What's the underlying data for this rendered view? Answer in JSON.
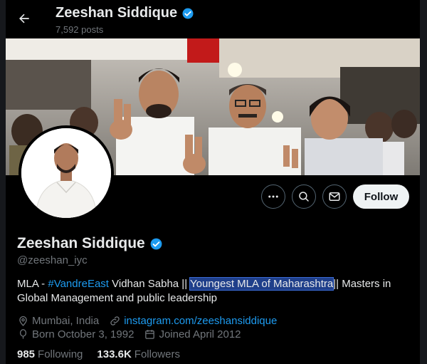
{
  "header": {
    "name": "Zeeshan Siddique",
    "posts": "7,592 posts",
    "back_icon": "arrow-left-icon",
    "verified_icon": "verified-badge-icon"
  },
  "profile": {
    "display_name": "Zeeshan Siddique",
    "handle": "@zeeshan_iyc",
    "bio": {
      "prefix": "MLA - ",
      "hashtag": "#VandreEast",
      "mid": " Vidhan Sabha || ",
      "highlighted": "Youngest MLA of Maharashtra",
      "suffix": "|| Masters in Global Management and public leadership"
    },
    "location": "Mumbai, India",
    "website": "instagram.com/zeeshansiddique",
    "born": "Born October 3, 1992",
    "joined": "Joined April 2012",
    "following_count": "985",
    "following_label": "Following",
    "followers_count": "133.6K",
    "followers_label": "Followers"
  },
  "actions": {
    "more_icon": "more-icon",
    "search_icon": "search-icon",
    "message_icon": "message-icon",
    "follow_label": "Follow"
  },
  "colors": {
    "background": "#000000",
    "accent": "#1d9bf0",
    "muted": "#71767b",
    "text": "#e7e9ea",
    "follow_bg": "#eff3f4"
  }
}
